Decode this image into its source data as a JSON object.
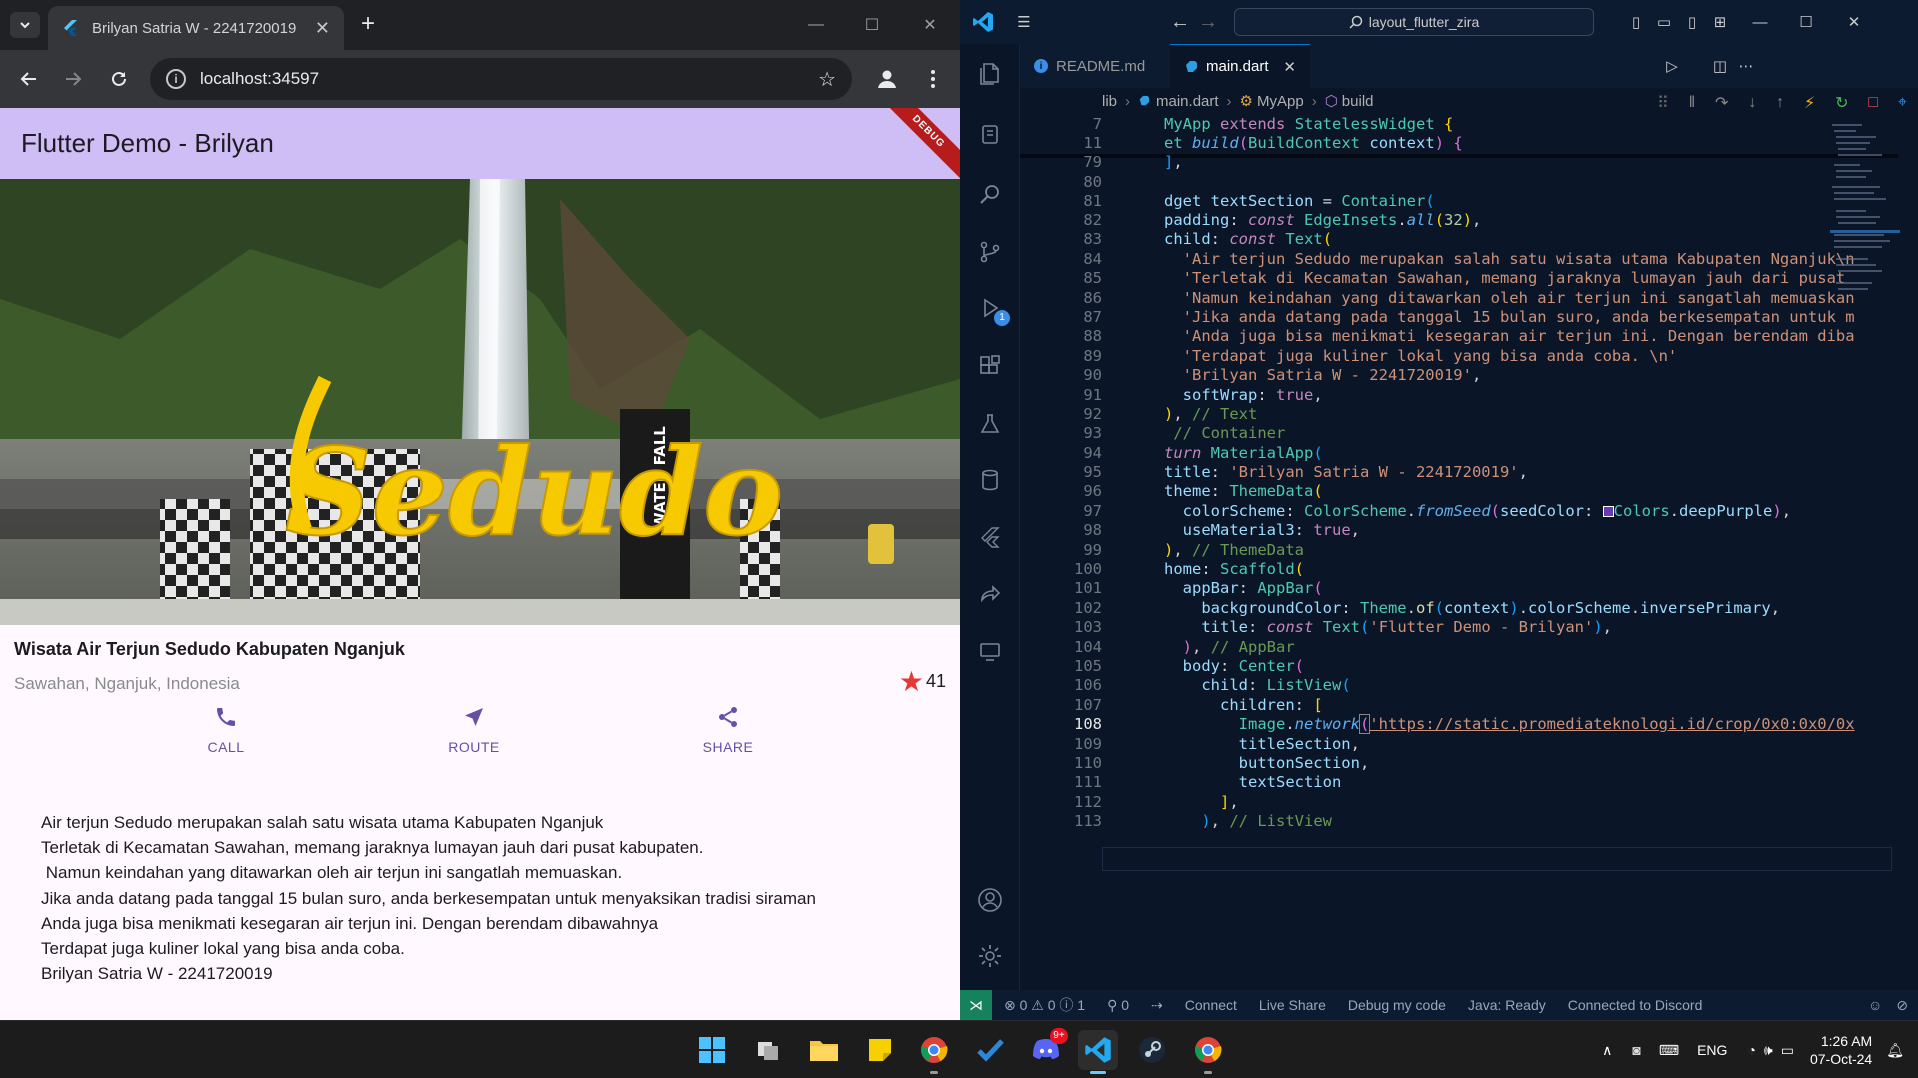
{
  "browser": {
    "tab_title": "Brilyan Satria W - 2241720019",
    "tab_close": "✕",
    "new_tab": "+",
    "address": "localhost:34597",
    "window": {
      "minimize": "—",
      "maximize": "☐",
      "close": "✕"
    }
  },
  "flutter": {
    "appbar_title": "Flutter Demo - Brilyan",
    "debug_banner": "DEBUG",
    "hero_sign": "Sedudo",
    "hero_sign_small": "WATER FALL",
    "place_name": "Wisata Air Terjun Sedudo Kabupaten Nganjuk",
    "location": "Sawahan, Nganjuk, Indonesia",
    "rating": "41",
    "buttons": [
      {
        "label": "CALL"
      },
      {
        "label": "ROUTE"
      },
      {
        "label": "SHARE"
      }
    ],
    "text_lines": [
      "Air terjun Sedudo merupakan salah satu wisata utama Kabupaten Nganjuk",
      "Terletak di Kecamatan Sawahan, memang jaraknya lumayan jauh dari pusat kabupaten.",
      " Namun keindahan yang ditawarkan oleh air terjun ini sangatlah memuaskan.",
      "Jika anda datang pada tanggal 15 bulan suro, anda berkesempatan untuk menyaksikan tradisi siraman",
      "Anda juga bisa menikmati kesegaran air terjun ini. Dengan berendam dibawahnya",
      "Terdapat juga kuliner lokal yang bisa anda coba.",
      "Brilyan Satria W - 2241720019"
    ]
  },
  "vscode": {
    "command_center": "layout_flutter_zira",
    "tabs": [
      {
        "label": "README.md"
      },
      {
        "label": "main.dart"
      }
    ],
    "tab_close": "✕",
    "breadcrumb": [
      "lib",
      "main.dart",
      "MyApp",
      "build"
    ],
    "line_numbers": [
      "7",
      "11",
      "79",
      "80",
      "81",
      "82",
      "83",
      "84",
      "85",
      "86",
      "87",
      "88",
      "89",
      "90",
      "91",
      "92",
      "93",
      "94",
      "95",
      "96",
      "97",
      "98",
      "99",
      "100",
      "101",
      "102",
      "103",
      "104",
      "105",
      "106",
      "107",
      "108",
      "109",
      "110",
      "111",
      "112",
      "113"
    ],
    "current_line": "108",
    "debug_badge": "1",
    "status": {
      "problems": "⊗ 0 ⚠ 0 ⓘ 1",
      "ports": "⚲ 0",
      "connect": "Connect",
      "live_share": "Live Share",
      "debug_my_code": "Debug my code",
      "java": "Java: Ready",
      "discord": "Connected to Discord"
    }
  },
  "taskbar": {
    "discord_badge": "9+",
    "lang": "ENG",
    "time": "1:26 AM",
    "date": "07-Oct-24"
  },
  "colors": {
    "appbar": "#cfbdf5",
    "accent": "#6750a4",
    "star": "#e53935",
    "vscode_bg": "#0a1628"
  }
}
